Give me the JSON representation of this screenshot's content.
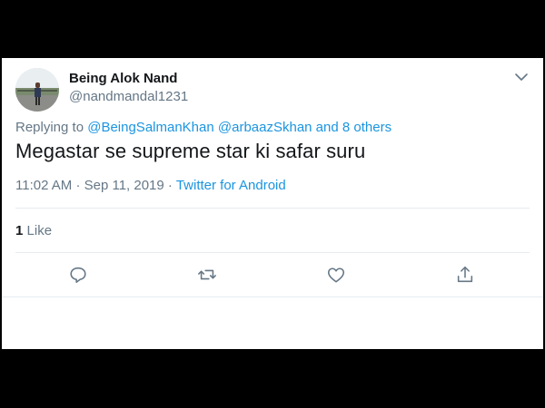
{
  "tweet": {
    "author": {
      "display_name": "Being Alok Nand",
      "handle": "@nandmandal1231",
      "avatar_icon": "user-avatar-photo"
    },
    "reply_to": {
      "prefix": "Replying to",
      "mentions": [
        "@BeingSalmanKhan",
        "@arbaazSkhan"
      ],
      "others": "and 8 others"
    },
    "text": "Megastar se supreme star ki safar suru",
    "meta": {
      "time": "11:02 AM",
      "separator": "·",
      "date": "Sep 11, 2019",
      "source": "Twitter for Android"
    },
    "stats": {
      "likes_count": "1",
      "likes_label": "Like"
    },
    "actions": {
      "reply_icon": "reply-icon",
      "retweet_icon": "retweet-icon",
      "like_icon": "heart-icon",
      "share_icon": "share-icon"
    },
    "menu_icon": "chevron-down-icon"
  },
  "colors": {
    "background": "#000000",
    "card": "#ffffff",
    "text_primary": "#14171a",
    "text_secondary": "#657786",
    "link": "#1b95e0",
    "divider": "#e6ecf0"
  }
}
